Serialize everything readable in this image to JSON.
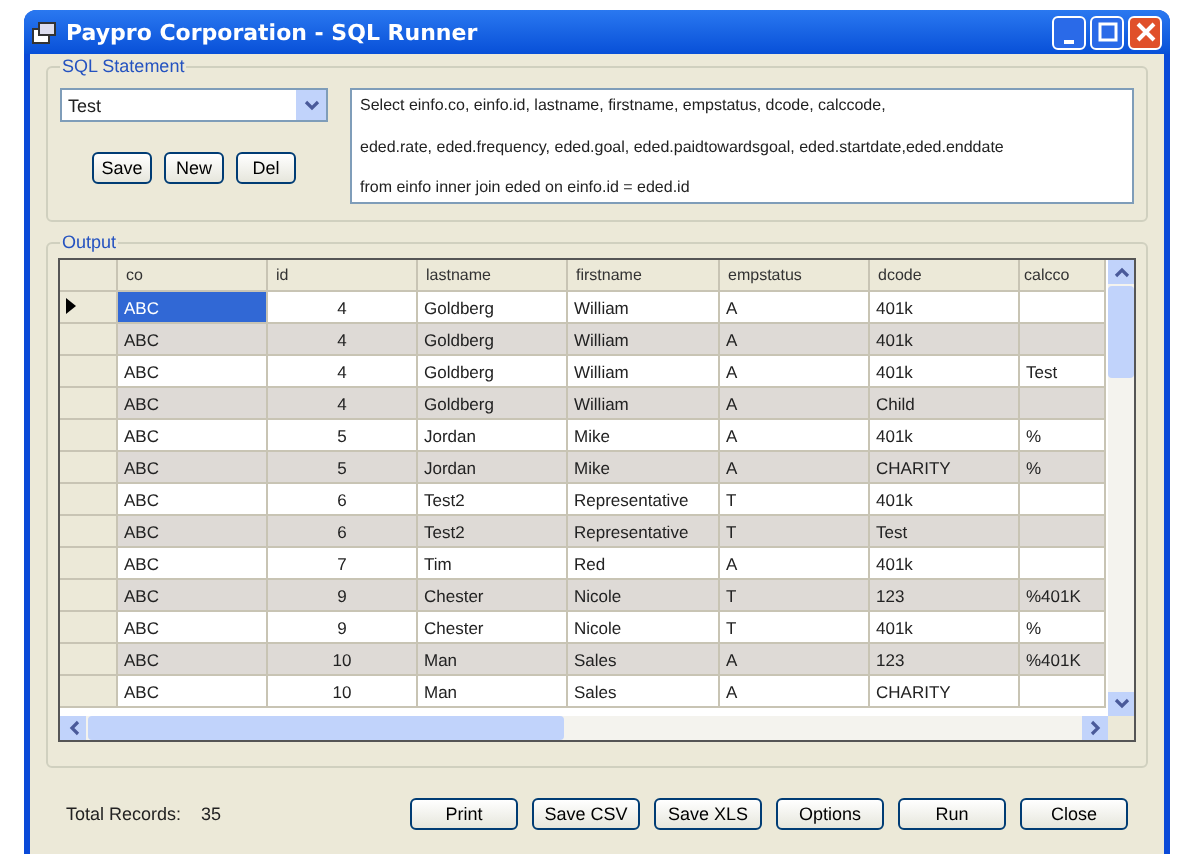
{
  "window": {
    "title": "Paypro Corporation - SQL Runner"
  },
  "sql_statement": {
    "label": "SQL Statement",
    "query_select": {
      "value": "Test"
    },
    "buttons": [
      "Save",
      "New",
      "Del"
    ],
    "query_lines": [
      "Select einfo.co, einfo.id, lastname, firstname, empstatus, dcode,  calccode,",
      "eded.rate, eded.frequency, eded.goal, eded.paidtowardsgoal, eded.startdate,eded.enddate",
      "from einfo inner join eded on einfo.id = eded.id"
    ]
  },
  "output": {
    "label": "Output",
    "table": {
      "columns": [
        "co",
        "id",
        "lastname",
        "firstname",
        "empstatus",
        "dcode",
        "calcco"
      ],
      "rows": [
        {
          "selected": true,
          "cells": [
            "ABC",
            "4",
            "Goldberg",
            "William",
            "A",
            "401k",
            ""
          ]
        },
        {
          "selected": false,
          "cells": [
            "ABC",
            "4",
            "Goldberg",
            "William",
            "A",
            "401k",
            ""
          ]
        },
        {
          "selected": false,
          "cells": [
            "ABC",
            "4",
            "Goldberg",
            "William",
            "A",
            "401k",
            "Test"
          ]
        },
        {
          "selected": false,
          "cells": [
            "ABC",
            "4",
            "Goldberg",
            "William",
            "A",
            "Child",
            ""
          ]
        },
        {
          "selected": false,
          "cells": [
            "ABC",
            "5",
            "Jordan",
            "Mike",
            "A",
            "401k",
            "%"
          ]
        },
        {
          "selected": false,
          "cells": [
            "ABC",
            "5",
            "Jordan",
            "Mike",
            "A",
            "CHARITY",
            "%"
          ]
        },
        {
          "selected": false,
          "cells": [
            "ABC",
            "6",
            "Test2",
            "Representative",
            "T",
            "401k",
            ""
          ]
        },
        {
          "selected": false,
          "cells": [
            "ABC",
            "6",
            "Test2",
            "Representative",
            "T",
            "Test",
            ""
          ]
        },
        {
          "selected": false,
          "cells": [
            "ABC",
            "7",
            "Tim",
            "Red",
            "A",
            "401k",
            ""
          ]
        },
        {
          "selected": false,
          "cells": [
            "ABC",
            "9",
            "Chester",
            "Nicole",
            "T",
            "123",
            "%401K"
          ]
        },
        {
          "selected": false,
          "cells": [
            "ABC",
            "9",
            "Chester",
            "Nicole",
            "T",
            "401k",
            "%"
          ]
        },
        {
          "selected": false,
          "cells": [
            "ABC",
            "10",
            "Man",
            "Sales",
            "A",
            "123",
            "%401K"
          ]
        },
        {
          "selected": false,
          "cells": [
            "ABC",
            "10",
            "Man",
            "Sales",
            "A",
            "CHARITY",
            ""
          ]
        }
      ]
    }
  },
  "footer": {
    "total_label": "Total Records:",
    "total_value": "35",
    "buttons": [
      "Print",
      "Save CSV",
      "Save XLS",
      "Options",
      "Run",
      "Close"
    ]
  }
}
